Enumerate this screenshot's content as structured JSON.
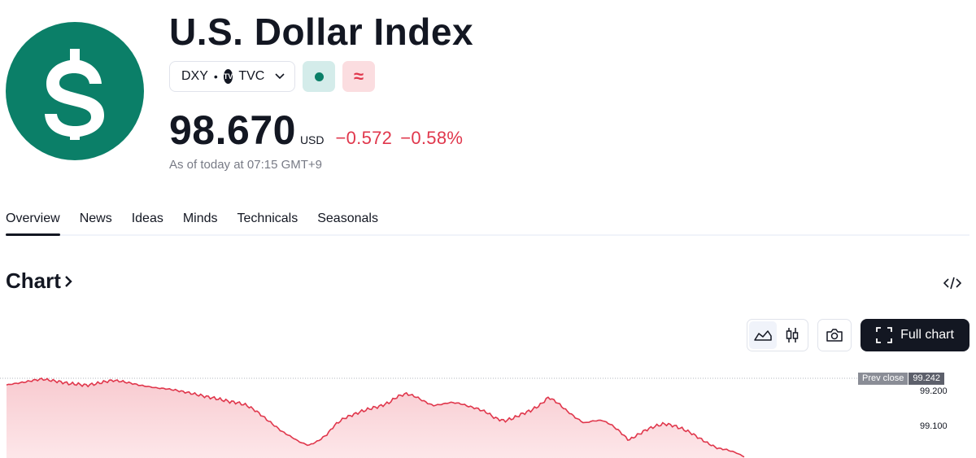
{
  "header": {
    "title": "U.S. Dollar Index",
    "logo_icon": "dollar-sign-icon",
    "ticker": "DXY",
    "separator": "•",
    "exchange": "TVC",
    "price": "98.670",
    "currency": "USD",
    "change": "−0.572",
    "change_percent": "−0.58%",
    "as_of": "As of today at 07:15 GMT+9"
  },
  "tabs": [
    {
      "label": "Overview",
      "active": true
    },
    {
      "label": "News",
      "active": false
    },
    {
      "label": "Ideas",
      "active": false
    },
    {
      "label": "Minds",
      "active": false
    },
    {
      "label": "Technicals",
      "active": false
    },
    {
      "label": "Seasonals",
      "active": false
    }
  ],
  "chart_section": {
    "title": "Chart",
    "full_chart_label": "Full chart",
    "prev_close_label": "Prev close",
    "prev_close_value": "99.242",
    "axis_labels": [
      "99.200",
      "99.100"
    ]
  },
  "colors": {
    "brand_green": "#0b7f68",
    "negative_red": "#e0374c",
    "dark": "#131722"
  },
  "chart_data": {
    "type": "area",
    "series_color": "#e0374c",
    "prev_close": 99.242,
    "y_ticks": [
      99.2,
      99.1
    ],
    "values": [
      99.223,
      99.227,
      99.231,
      99.236,
      99.24,
      99.236,
      99.232,
      99.227,
      99.225,
      99.222,
      99.226,
      99.232,
      99.236,
      99.233,
      99.228,
      99.222,
      99.218,
      99.214,
      99.212,
      99.208,
      99.203,
      99.198,
      99.192,
      99.187,
      99.182,
      99.176,
      99.172,
      99.165,
      99.15,
      99.13,
      99.11,
      99.09,
      99.075,
      99.06,
      99.05,
      99.062,
      99.08,
      99.11,
      99.128,
      99.138,
      99.148,
      99.156,
      99.162,
      99.172,
      99.19,
      99.198,
      99.19,
      99.176,
      99.164,
      99.168,
      99.173,
      99.17,
      99.162,
      99.155,
      99.145,
      99.128,
      99.12,
      99.128,
      99.14,
      99.15,
      99.165,
      99.188,
      99.172,
      99.15,
      99.13,
      99.114,
      99.12,
      99.122,
      99.11,
      99.09,
      99.065,
      99.08,
      99.095,
      99.105,
      99.112,
      99.107,
      99.098,
      99.086,
      99.07,
      99.055,
      99.042,
      99.038,
      99.03,
      99.018
    ]
  }
}
